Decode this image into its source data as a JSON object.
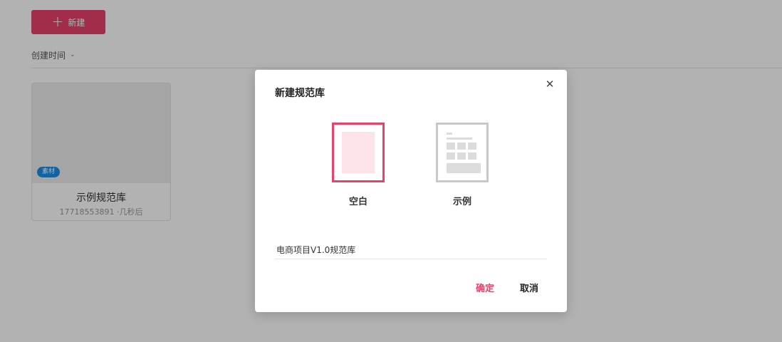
{
  "toolbar": {
    "new_label": "新建",
    "plus_icon": "+"
  },
  "sort": {
    "label": "创建时间",
    "chevron": "⌄"
  },
  "library_cards": [
    {
      "badge": "素材",
      "title": "示例规范库",
      "meta": "17718553891 ·几秒后"
    }
  ],
  "dialog": {
    "title": "新建规范库",
    "close_icon": "✕",
    "templates": [
      {
        "label": "空白",
        "selected": true
      },
      {
        "label": "示例",
        "selected": false
      }
    ],
    "name_field": {
      "value": "电商项目V1.0规范库"
    },
    "confirm_label": "确定",
    "cancel_label": "取消"
  },
  "colors": {
    "accent": "#e8416a",
    "badge": "#1e8fe6",
    "overlay": "rgba(0,0,0,0.30)"
  }
}
